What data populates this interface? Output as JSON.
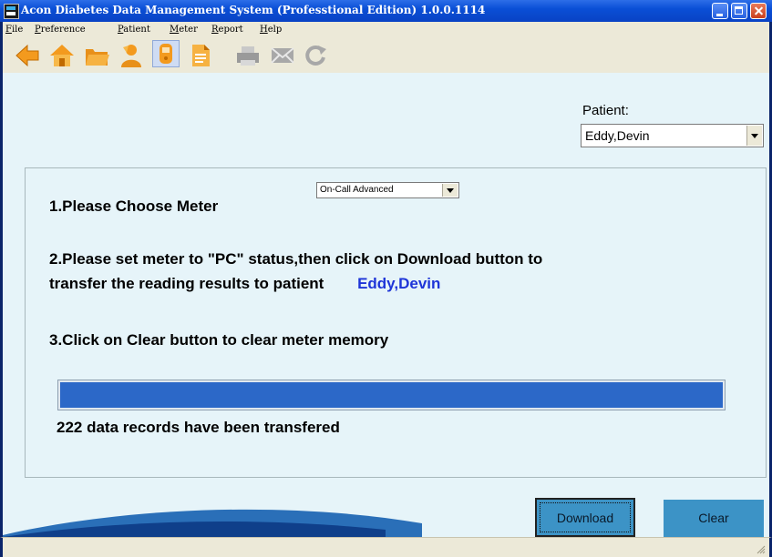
{
  "window": {
    "title": "Acon Diabetes Data Management System (Professtional Edition) 1.0.0.1114"
  },
  "menu": [
    {
      "accel": "F",
      "rest": "ile"
    },
    {
      "accel": "P",
      "rest": "reference"
    },
    {
      "accel": "P",
      "rest": "atient"
    },
    {
      "accel": "M",
      "rest": "eter"
    },
    {
      "accel": "R",
      "rest": "eport"
    },
    {
      "accel": "H",
      "rest": "elp"
    }
  ],
  "toolbar_icons": [
    "back-arrow-icon",
    "home-icon",
    "folder-icon",
    "patient-icon",
    "meter-icon",
    "document-icon",
    "print-icon",
    "email-icon",
    "refresh-icon"
  ],
  "patient": {
    "label": "Patient:",
    "selected": "Eddy,Devin"
  },
  "steps": {
    "step1": "1.Please Choose Meter",
    "meter_selected": "On-Call Advanced",
    "step2_line1": "2.Please set meter to \"PC\" status,then click on Download button to",
    "step2_line2": "transfer the reading results to patient",
    "step2_patient": "Eddy,Devin",
    "step3": "3.Click on Clear button to clear meter memory"
  },
  "progress": {
    "fraction": 1.0,
    "status": "222 data records have been transfered"
  },
  "buttons": {
    "download": "Download",
    "clear": "Clear"
  },
  "colors": {
    "accent": "#2c68c8",
    "button": "#3c93c6",
    "background": "#e6f4f9"
  }
}
